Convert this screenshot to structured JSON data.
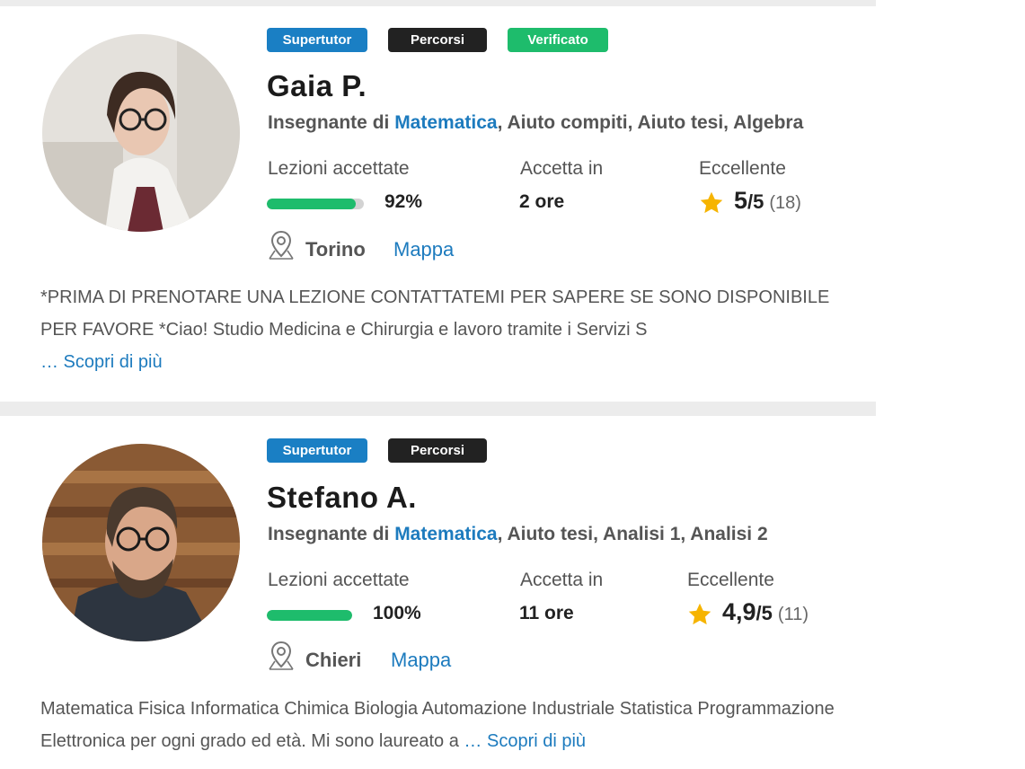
{
  "tutors": [
    {
      "badges": {
        "supertutor": "Supertutor",
        "percorsi": "Percorsi",
        "verificato": "Verificato"
      },
      "name": "Gaia P.",
      "subjects_prefix": "Insegnante di ",
      "subjects_highlight": "Matematica",
      "subjects_rest": ", Aiuto compiti, Aiuto tesi, Algebra",
      "stats": {
        "accepted_label": "Lezioni accettate",
        "accepted_value": "92%",
        "accepted_fraction": 0.92,
        "accepts_label": "Accetta in",
        "accepts_value": "2 ore",
        "rating_label": "Eccellente",
        "rating_value": "5",
        "rating_suffix": "/5",
        "rating_count": "(18)"
      },
      "city": "Torino",
      "map_link": "Mappa",
      "description": "*PRIMA DI PRENOTARE UNA LEZIONE CONTATTATEMI PER SAPERE SE SONO DISPONIBILE PER FAVORE *Ciao! Studio Medicina e Chirurgia e lavoro tramite i Servizi S",
      "more_link": "… Scopri di più"
    },
    {
      "badges": {
        "supertutor": "Supertutor",
        "percorsi": "Percorsi"
      },
      "name": "Stefano A.",
      "subjects_prefix": "Insegnante di ",
      "subjects_highlight": "Matematica",
      "subjects_rest": ", Aiuto tesi, Analisi 1, Analisi 2",
      "stats": {
        "accepted_label": "Lezioni accettate",
        "accepted_value": "100%",
        "accepted_fraction": 1.0,
        "accepts_label": "Accetta in",
        "accepts_value": "11 ore",
        "rating_label": "Eccellente",
        "rating_value": "4,9",
        "rating_suffix": "/5",
        "rating_count": "(11)"
      },
      "city": "Chieri",
      "map_link": "Mappa",
      "description": "Matematica Fisica Informatica Chimica Biologia Automazione Industriale Statistica Programmazione Elettronica per ogni grado ed età. Mi sono laureato a",
      "more_link": "… Scopri di più"
    }
  ],
  "icons": {
    "location": "map-pin-icon",
    "star": "star-icon"
  },
  "colors": {
    "accent": "#1d7bbe",
    "supertutor": "#1a7fc4",
    "percorsi": "#222222",
    "verificato": "#1ebc6c",
    "progress": "#1ebc6c",
    "star": "#f6b400"
  }
}
